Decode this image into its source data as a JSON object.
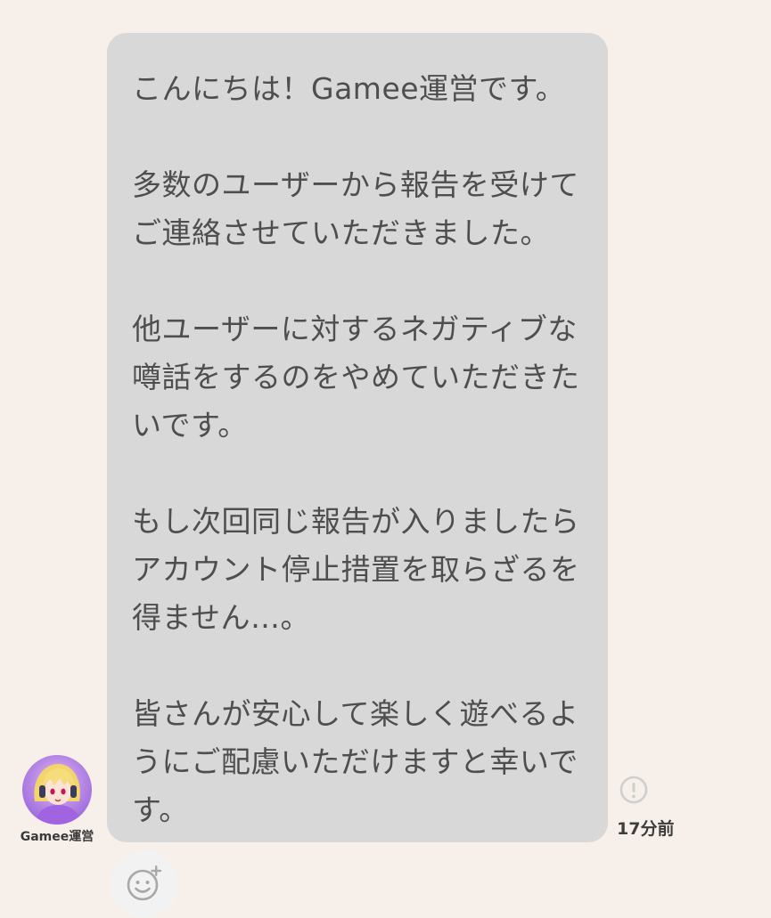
{
  "message": {
    "lines": [
      "こんにちは！Gamee運営です。",
      "",
      "多数のユーザーから報告を受けて",
      "ご連絡させていただきました。",
      "",
      "他ユーザーに対するネガティブな",
      "噂話をするのをやめていただきた",
      "いです。",
      "",
      "もし次回同じ報告が入りましたら",
      "アカウント停止措置を取らざるを",
      "得ません…。",
      "",
      "皆さんが安心して楽しく遊べるよ",
      "うにご配慮いただけますと幸いで",
      "す。"
    ]
  },
  "sender": {
    "name": "Gamee運営",
    "avatar": "anime-character-avatar"
  },
  "meta": {
    "timestamp": "17分前",
    "report_icon": "exclamation-circle-icon"
  },
  "actions": {
    "reaction_icon": "add-reaction-smiley-icon"
  },
  "colors": {
    "background": "#f7f0ea",
    "bubble": "#d8d8d8",
    "text": "#4e4e4e"
  }
}
